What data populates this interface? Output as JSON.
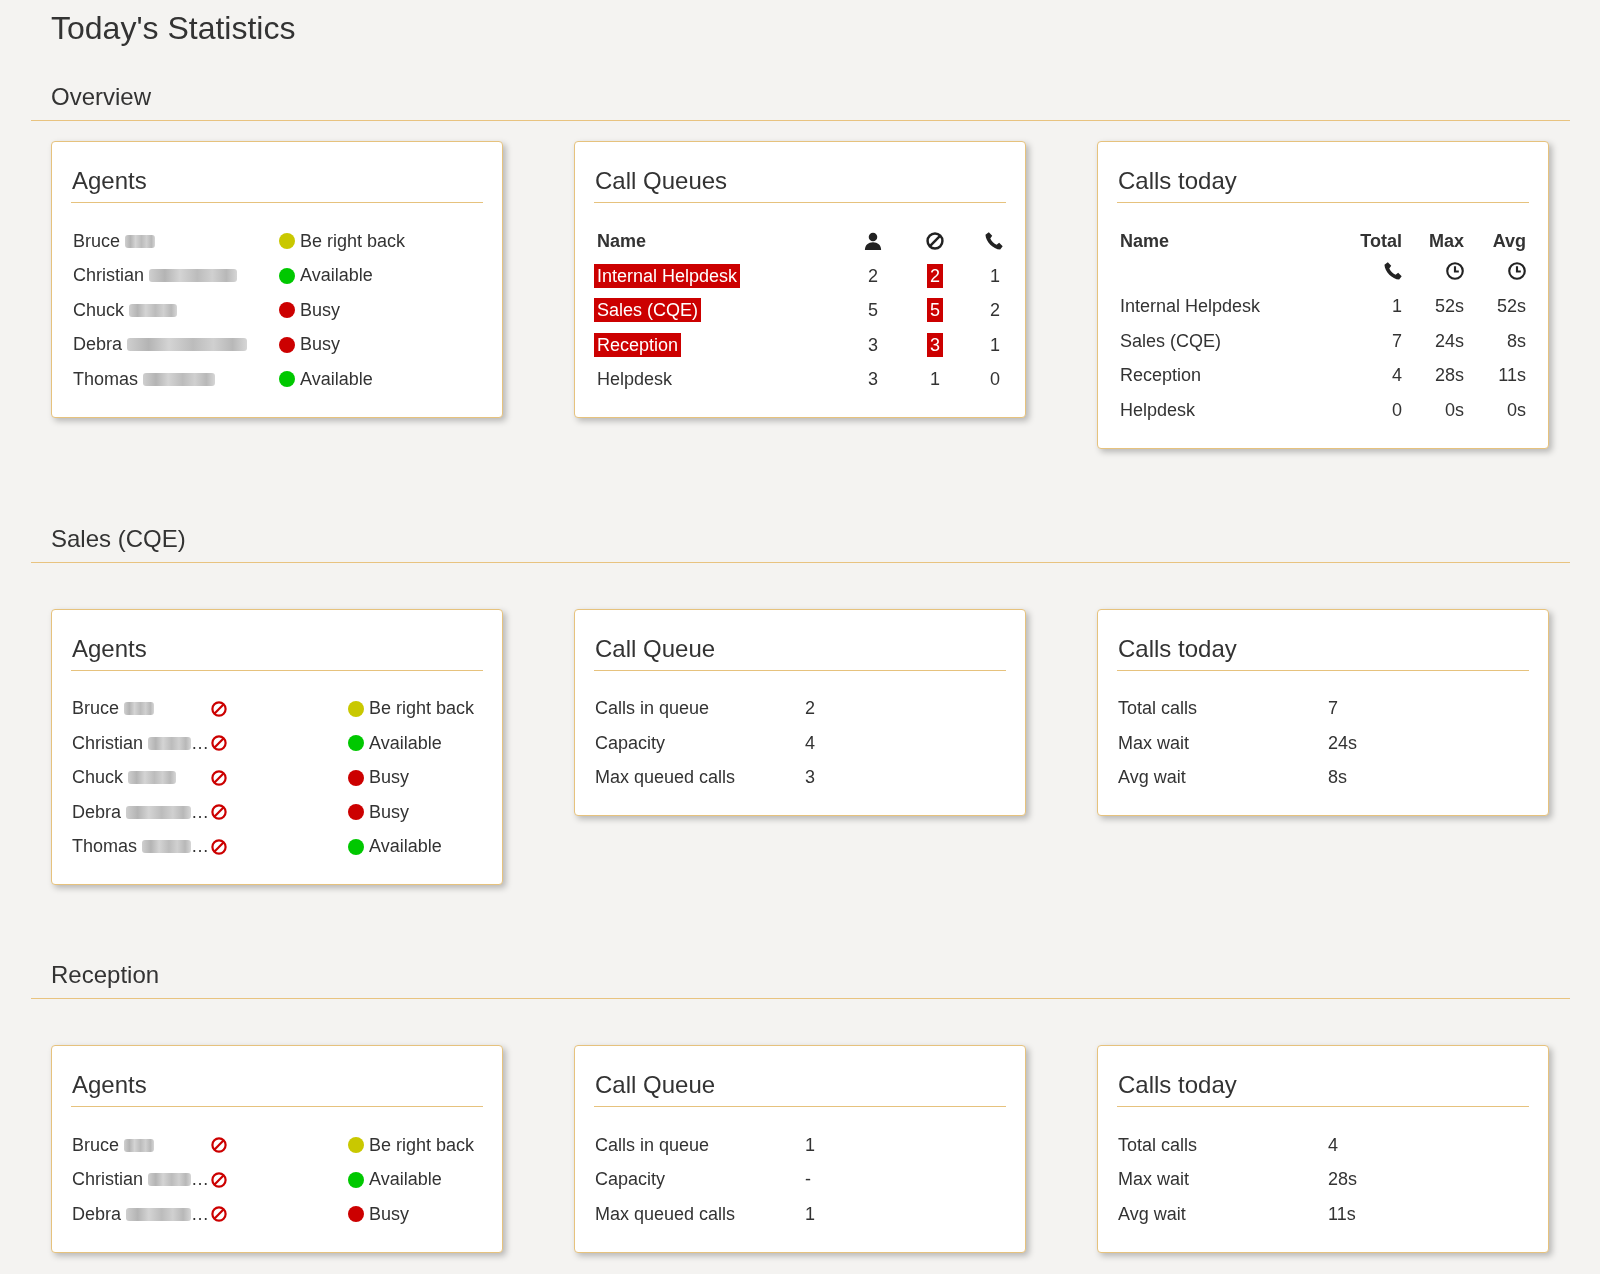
{
  "page": {
    "title": "Today's Statistics"
  },
  "sections": [
    {
      "heading": "Overview",
      "cards": [
        {
          "kind": "agents",
          "title": "Agents",
          "agents": [
            {
              "name": "Bruce",
              "redacted": true,
              "status": "Be right back",
              "color": "#c9c800"
            },
            {
              "name": "Christian",
              "redacted": true,
              "status": "Available",
              "color": "#00c800"
            },
            {
              "name": "Chuck",
              "redacted": true,
              "status": "Busy",
              "color": "#cc0000"
            },
            {
              "name": "Debra",
              "redacted": true,
              "status": "Busy",
              "color": "#cc0000"
            },
            {
              "name": "Thomas",
              "redacted": true,
              "status": "Available",
              "color": "#00c800"
            }
          ]
        },
        {
          "kind": "queue_table",
          "title": "Call Queues",
          "name_heading": "Name",
          "rows": [
            {
              "name": "Internal Helpdesk",
              "column_2": "2",
              "column_3": "2",
              "column_4": "1",
              "alert": true
            },
            {
              "name": "Sales (CQE)",
              "column_2": "5",
              "column_3": "5",
              "column_4": "2",
              "alert": true
            },
            {
              "name": "Reception",
              "column_2": "3",
              "column_3": "3",
              "column_4": "1",
              "alert": true
            },
            {
              "name": "Helpdesk",
              "column_2": "3",
              "column_3": "1",
              "column_4": "0",
              "alert": false
            }
          ]
        },
        {
          "kind": "calls_table",
          "title": "Calls today",
          "columns": [
            "Name",
            "Total",
            "Max",
            "Avg"
          ],
          "rows": [
            {
              "name": "Internal Helpdesk",
              "total": "1",
              "max": "52s",
              "avg": "52s"
            },
            {
              "name": "Sales (CQE)",
              "total": "7",
              "max": "24s",
              "avg": "8s"
            },
            {
              "name": "Reception",
              "total": "4",
              "max": "28s",
              "avg": "11s"
            },
            {
              "name": "Helpdesk",
              "total": "0",
              "max": "0s",
              "avg": "0s"
            }
          ]
        }
      ]
    },
    {
      "heading": "Sales (CQE)",
      "cards": [
        {
          "kind": "agents",
          "title": "Agents",
          "agents": [
            {
              "name": "Bruce",
              "redacted": true,
              "not_allowed": true,
              "status": "Be right back",
              "color": "#c9c800"
            },
            {
              "name": "Christian",
              "redacted": true,
              "truncation": "…",
              "not_allowed": true,
              "status": "Available",
              "color": "#00c800"
            },
            {
              "name": "Chuck",
              "redacted": true,
              "not_allowed": true,
              "status": "Busy",
              "color": "#cc0000"
            },
            {
              "name": "Debra",
              "redacted": true,
              "truncation": "…",
              "not_allowed": true,
              "status": "Busy",
              "color": "#cc0000"
            },
            {
              "name": "Thomas",
              "redacted": true,
              "truncation": "…",
              "not_allowed": true,
              "status": "Available",
              "color": "#00c800"
            }
          ]
        },
        {
          "kind": "stats",
          "title": "Call Queue",
          "items": [
            {
              "label": "Calls in queue",
              "value": "2"
            },
            {
              "label": "Capacity",
              "value": "4"
            },
            {
              "label": "Max queued calls",
              "value": "3"
            }
          ]
        },
        {
          "kind": "stats",
          "title": "Calls today",
          "items": [
            {
              "label": "Total calls",
              "value": "7"
            },
            {
              "label": "Max wait",
              "value": "24s"
            },
            {
              "label": "Avg wait",
              "value": "8s"
            }
          ]
        }
      ]
    },
    {
      "heading": "Reception",
      "cards": [
        {
          "kind": "agents",
          "title": "Agents",
          "agents": [
            {
              "name": "Bruce",
              "redacted": true,
              "not_allowed": true,
              "status": "Be right back",
              "color": "#c9c800"
            },
            {
              "name": "Christian",
              "redacted": true,
              "truncation": "…",
              "not_allowed": true,
              "status": "Available",
              "color": "#00c800"
            },
            {
              "name": "Debra",
              "redacted": true,
              "truncation": "…",
              "not_allowed": true,
              "status": "Busy",
              "color": "#cc0000"
            }
          ]
        },
        {
          "kind": "stats",
          "title": "Call Queue",
          "items": [
            {
              "label": "Calls in queue",
              "value": "1"
            },
            {
              "label": "Capacity",
              "value": "-"
            },
            {
              "label": "Max queued calls",
              "value": "1"
            }
          ]
        },
        {
          "kind": "stats",
          "title": "Calls today",
          "items": [
            {
              "label": "Total calls",
              "value": "4"
            },
            {
              "label": "Max wait",
              "value": "28s"
            },
            {
              "label": "Avg wait",
              "value": "11s"
            }
          ]
        }
      ]
    }
  ]
}
